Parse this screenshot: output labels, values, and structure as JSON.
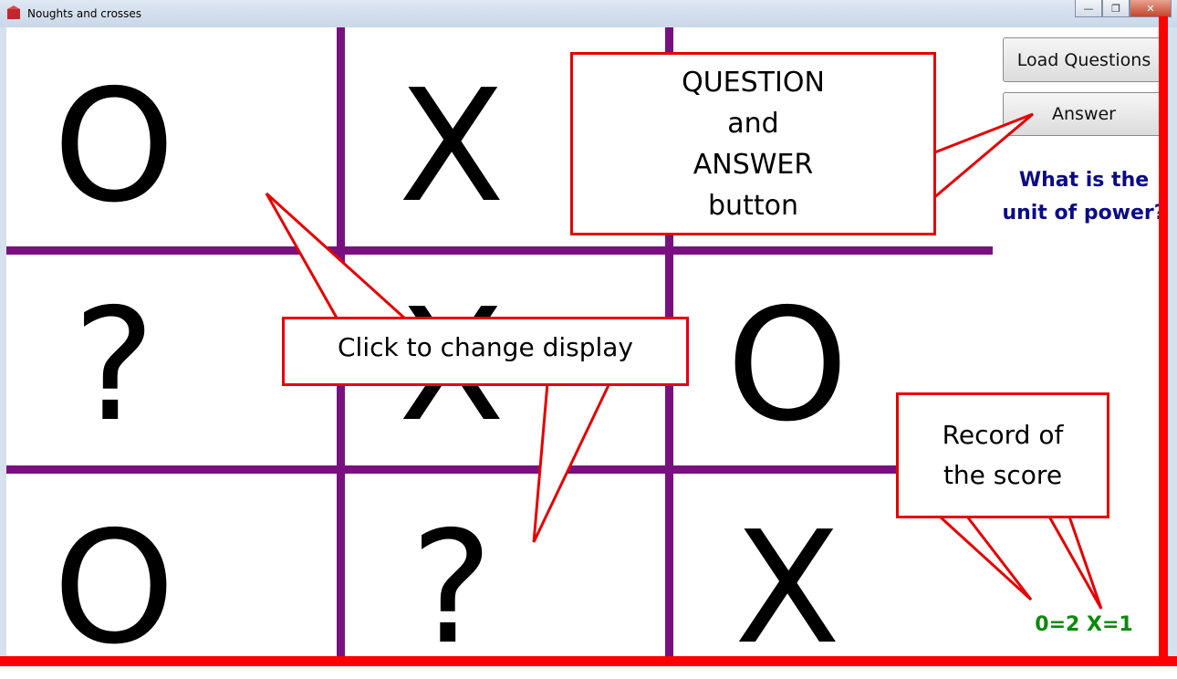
{
  "window": {
    "title": "Noughts and crosses",
    "minimize": "—",
    "maximize": "❐",
    "close": "✕"
  },
  "board": {
    "cells": [
      "O",
      "X",
      "",
      "?",
      "X",
      "O",
      "O",
      "?",
      "X"
    ]
  },
  "controls": {
    "load_questions_label": "Load Questions",
    "answer_label": "Answer"
  },
  "question": {
    "text": "What is the unit of power?"
  },
  "score": {
    "text": "0=2 X=1"
  },
  "callouts": {
    "qa_line1": "QUESTION",
    "qa_line2": "and",
    "qa_line3": "ANSWER",
    "qa_line4": "button",
    "click": "Click to change display",
    "record_line1": "Record of",
    "record_line2": "the score"
  },
  "colors": {
    "grid": "#7a1080",
    "callout_border": "#e60000",
    "question_text": "#0b0b86",
    "score_text": "#0a8a0a"
  }
}
